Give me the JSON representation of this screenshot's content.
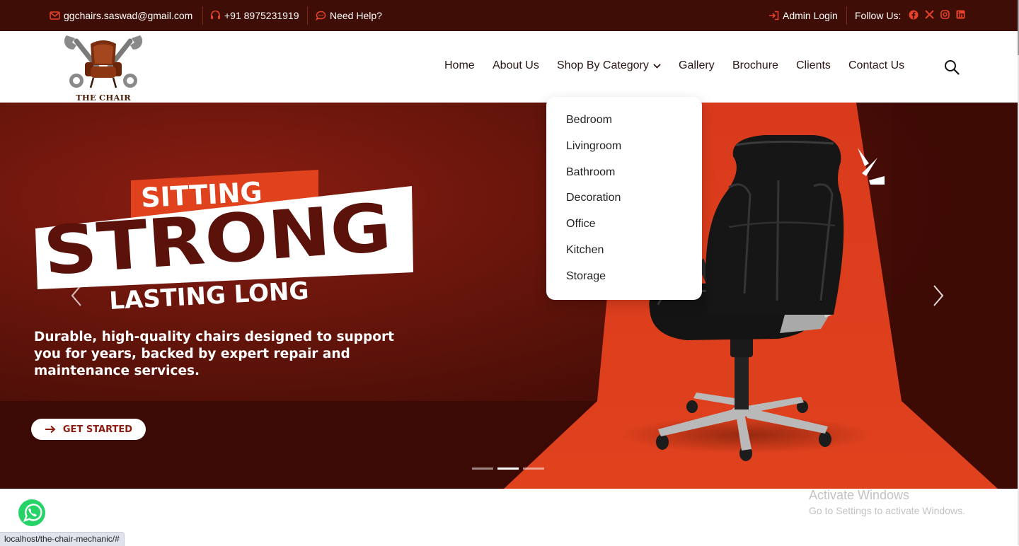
{
  "topbar": {
    "email": "ggchairs.saswad@gmail.com",
    "phone": "+91 8975231919",
    "help": "Need Help?",
    "admin_login": "Admin Login",
    "follow_us": "Follow Us:",
    "social_icons": [
      "facebook-icon",
      "x-icon",
      "instagram-icon",
      "linkedin-icon"
    ]
  },
  "logo": {
    "text": "THE CHAIR MECHANIC"
  },
  "nav": {
    "home": "Home",
    "about": "About Us",
    "shop": "Shop By Category",
    "gallery": "Gallery",
    "brochure": "Brochure",
    "clients": "Clients",
    "contact": "Contact Us"
  },
  "dropdown": {
    "items": [
      "Bedroom",
      "Livingroom",
      "Bathroom",
      "Decoration",
      "Office",
      "Kitchen",
      "Storage"
    ]
  },
  "hero": {
    "headline_top": "SITTING",
    "headline_main": "STRONG",
    "headline_bottom": "LASTING LONG",
    "subtitle": "Durable, high-quality chairs designed to support you for years, backed by expert repair and maintenance services.",
    "cta": "GET STARTED",
    "slide_count": 3,
    "active_slide": 2
  },
  "windows": {
    "activate_title": "Activate Windows",
    "activate_sub": "Go to Settings to activate Windows."
  },
  "status_bar": {
    "url": "localhost/the-chair-mechanic/#"
  },
  "colors": {
    "topbar_bg": "#3e0d05",
    "accent_orange": "#e8432a",
    "hero_dark": "#5a1209",
    "spotlight": "#d93a1c",
    "cta_text": "#8c1a10"
  }
}
